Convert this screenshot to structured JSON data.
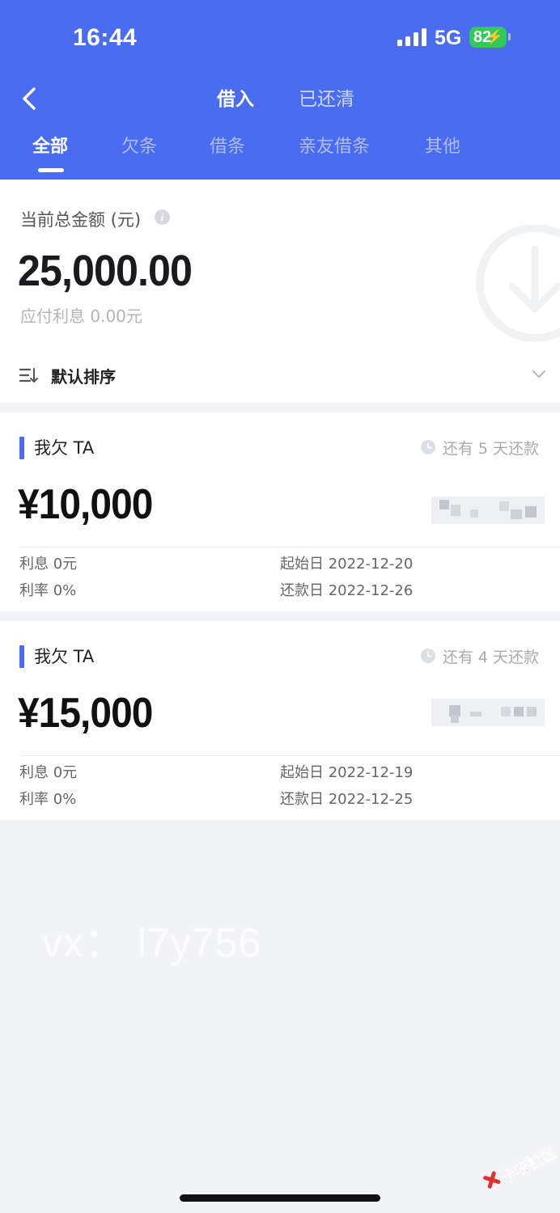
{
  "status_bar": {
    "time": "16:44",
    "network": "5G",
    "battery": "82",
    "battery_color": "#33c85a"
  },
  "nav": {
    "back_icon": "chevron-left-icon",
    "tabs": [
      {
        "label": "借入",
        "active": true
      },
      {
        "label": "已还清",
        "active": false
      }
    ],
    "sub_tabs": [
      {
        "label": "全部",
        "active": true
      },
      {
        "label": "欠条",
        "active": false
      },
      {
        "label": "借条",
        "active": false
      },
      {
        "label": "亲友借条",
        "active": false
      },
      {
        "label": "其他",
        "active": false
      }
    ],
    "accent_color": "#4a6cf0"
  },
  "summary": {
    "label": "当前总金额 (元)",
    "info_icon": "i",
    "amount": "25,000.00",
    "interest": "应付利息 0.00元",
    "sort_label": "默认排序"
  },
  "debts": [
    {
      "title": "我欠 TA",
      "due": "还有 5 天还款",
      "amount": "¥10,000",
      "interest": "利息 0元",
      "rate": "利率 0%",
      "start": "起始日 2022-12-20",
      "repay": "还款日 2022-12-26"
    },
    {
      "title": "我欠 TA",
      "due": "还有 4 天还款",
      "amount": "¥15,000",
      "interest": "利息 0元",
      "rate": "利率 0%",
      "start": "起始日 2022-12-19",
      "repay": "还款日 2022-12-25"
    }
  ],
  "watermark": {
    "text": "vx： l7y756",
    "logo_text": "卡农社区"
  }
}
